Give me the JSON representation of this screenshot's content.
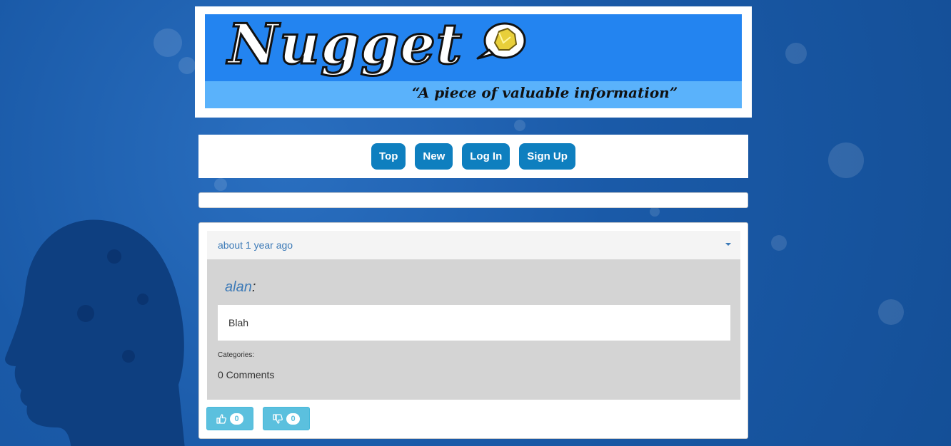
{
  "banner": {
    "logo_text": "Nugget",
    "tagline": "“A piece of valuable information”"
  },
  "nav": {
    "items": [
      "Top",
      "New",
      "Log In",
      "Sign Up"
    ]
  },
  "post": {
    "time": "about 1 year ago",
    "author": "alan",
    "separator": ":",
    "content": "Blah",
    "categories_label": "Categories:",
    "comments": "0 Comments",
    "upvotes": "0",
    "downvotes": "0"
  },
  "colors": {
    "background": "#1a5aa8",
    "nav_button": "#0e7fbf",
    "vote_button": "#5bc0de",
    "link": "#3c7ab7"
  },
  "icons": {
    "menu": "caret-down-icon",
    "upvote": "thumbs-up-icon",
    "downvote": "thumbs-down-icon"
  }
}
